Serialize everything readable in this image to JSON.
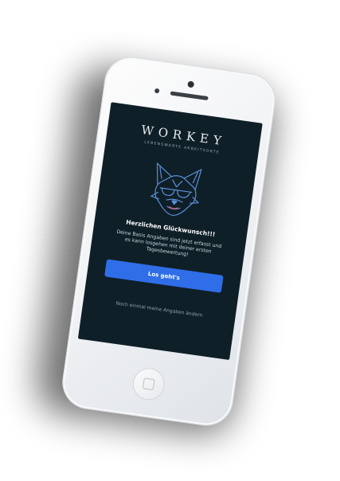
{
  "app": {
    "brand": "WORKEY",
    "tagline": "LEBENSWERTE ARBEITSORTE"
  },
  "onboarding": {
    "headline": "Herzlichen Glückwunsch!!!",
    "body_lines": [
      "Deine Basis Angaben sind jetzt erfasst und",
      "es kann losgehen mit deiner ersten",
      "Tagesbewertung!"
    ],
    "primary_button_label": "Los geht's",
    "secondary_link_label": "Noch einmal meine Angaben ändern"
  },
  "icons": {
    "mascot": "fox-with-sunglasses-icon",
    "home": "home-button-icon"
  },
  "colors": {
    "screen_bg": "#0f1f28",
    "accent_blue": "#2f6ee8",
    "mascot_line": "#5b8fd6"
  }
}
